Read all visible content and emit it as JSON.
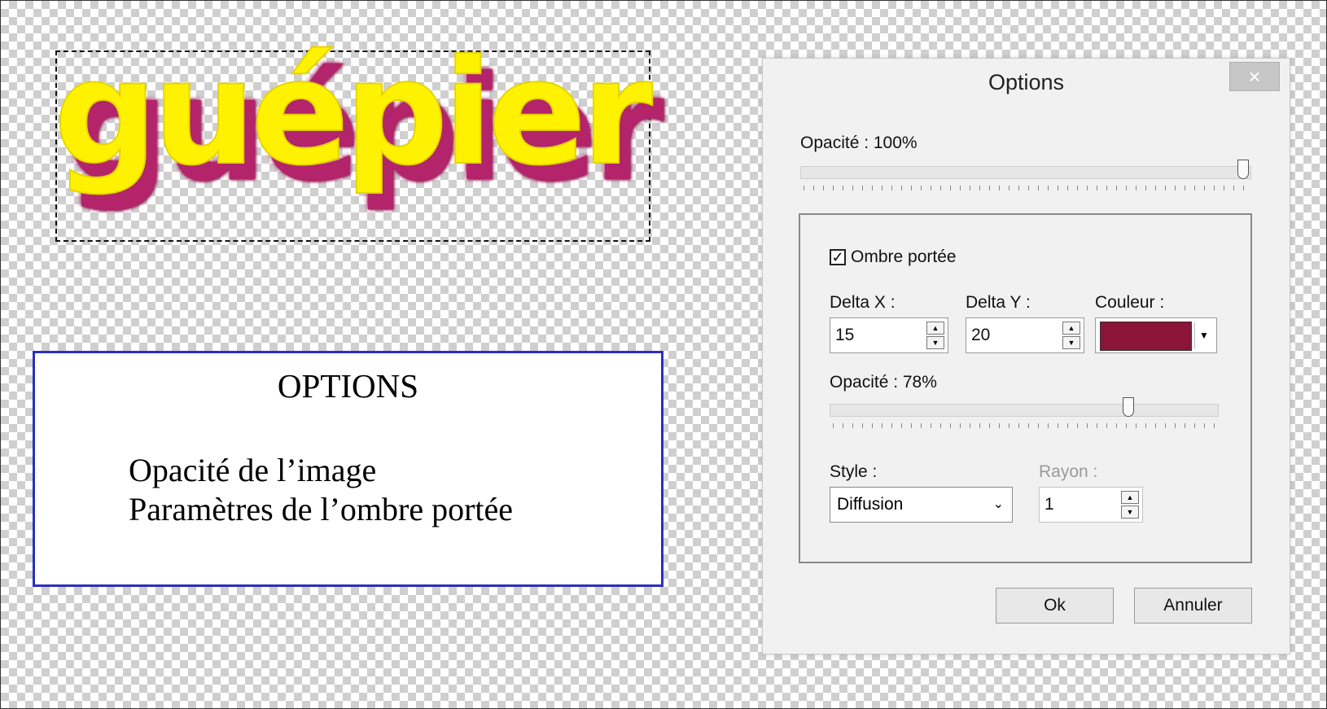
{
  "canvas": {
    "word": "guépier",
    "fill_color": "#fff200",
    "shadow_color": "#b3246a"
  },
  "info_box": {
    "title": "OPTIONS",
    "lines": [
      "Opacité de l’image",
      "Paramètres de l’ombre portée"
    ],
    "border_color": "#2b2fbf"
  },
  "dialog": {
    "title": "Options",
    "close_label": "×",
    "image_opacity_label": "Opacité : 100%",
    "image_opacity": 1.0,
    "drop_shadow": {
      "checkbox_label": "Ombre portée",
      "checked": true,
      "delta_x_label": "Delta X :",
      "delta_x": "15",
      "delta_y_label": "Delta Y :",
      "delta_y": "20",
      "color_label": "Couleur :",
      "color": "#8b1538",
      "opacity_label": "Opacité : 78%",
      "opacity": 0.78,
      "style_label": "Style :",
      "style_value": "Diffusion",
      "radius_label": "Rayon :",
      "radius_value": "1"
    },
    "ok_label": "Ok",
    "cancel_label": "Annuler"
  }
}
